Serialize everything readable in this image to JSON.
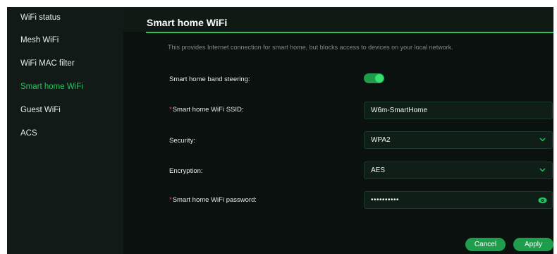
{
  "sidebar": {
    "items": [
      {
        "label": "WiFi status"
      },
      {
        "label": "Mesh WiFi"
      },
      {
        "label": "WiFi MAC filter"
      },
      {
        "label": "Smart home WiFi"
      },
      {
        "label": "Guest WiFi"
      },
      {
        "label": "ACS"
      }
    ],
    "active_index": 3
  },
  "page": {
    "title": "Smart home WiFi",
    "description": "This provides Internet connection for smart home, but blocks access to devices on your local network."
  },
  "form": {
    "band_steering": {
      "label": "Smart home band steering:",
      "enabled": true
    },
    "ssid": {
      "required_mark": "*",
      "label": "Smart home WiFi SSID:",
      "value": "W6m-SmartHome"
    },
    "security": {
      "label": "Security:",
      "value": "WPA2"
    },
    "encryption": {
      "label": "Encryption:",
      "value": "AES"
    },
    "password": {
      "required_mark": "*",
      "label": "Smart home WiFi password:",
      "value": "••••••••••"
    }
  },
  "actions": {
    "cancel_label": "Cancel",
    "apply_label": "Apply"
  },
  "colors": {
    "accent": "#22c55e",
    "background": "#0b120f",
    "sidebar": "#111a16",
    "field_bg": "#0f1f17"
  }
}
